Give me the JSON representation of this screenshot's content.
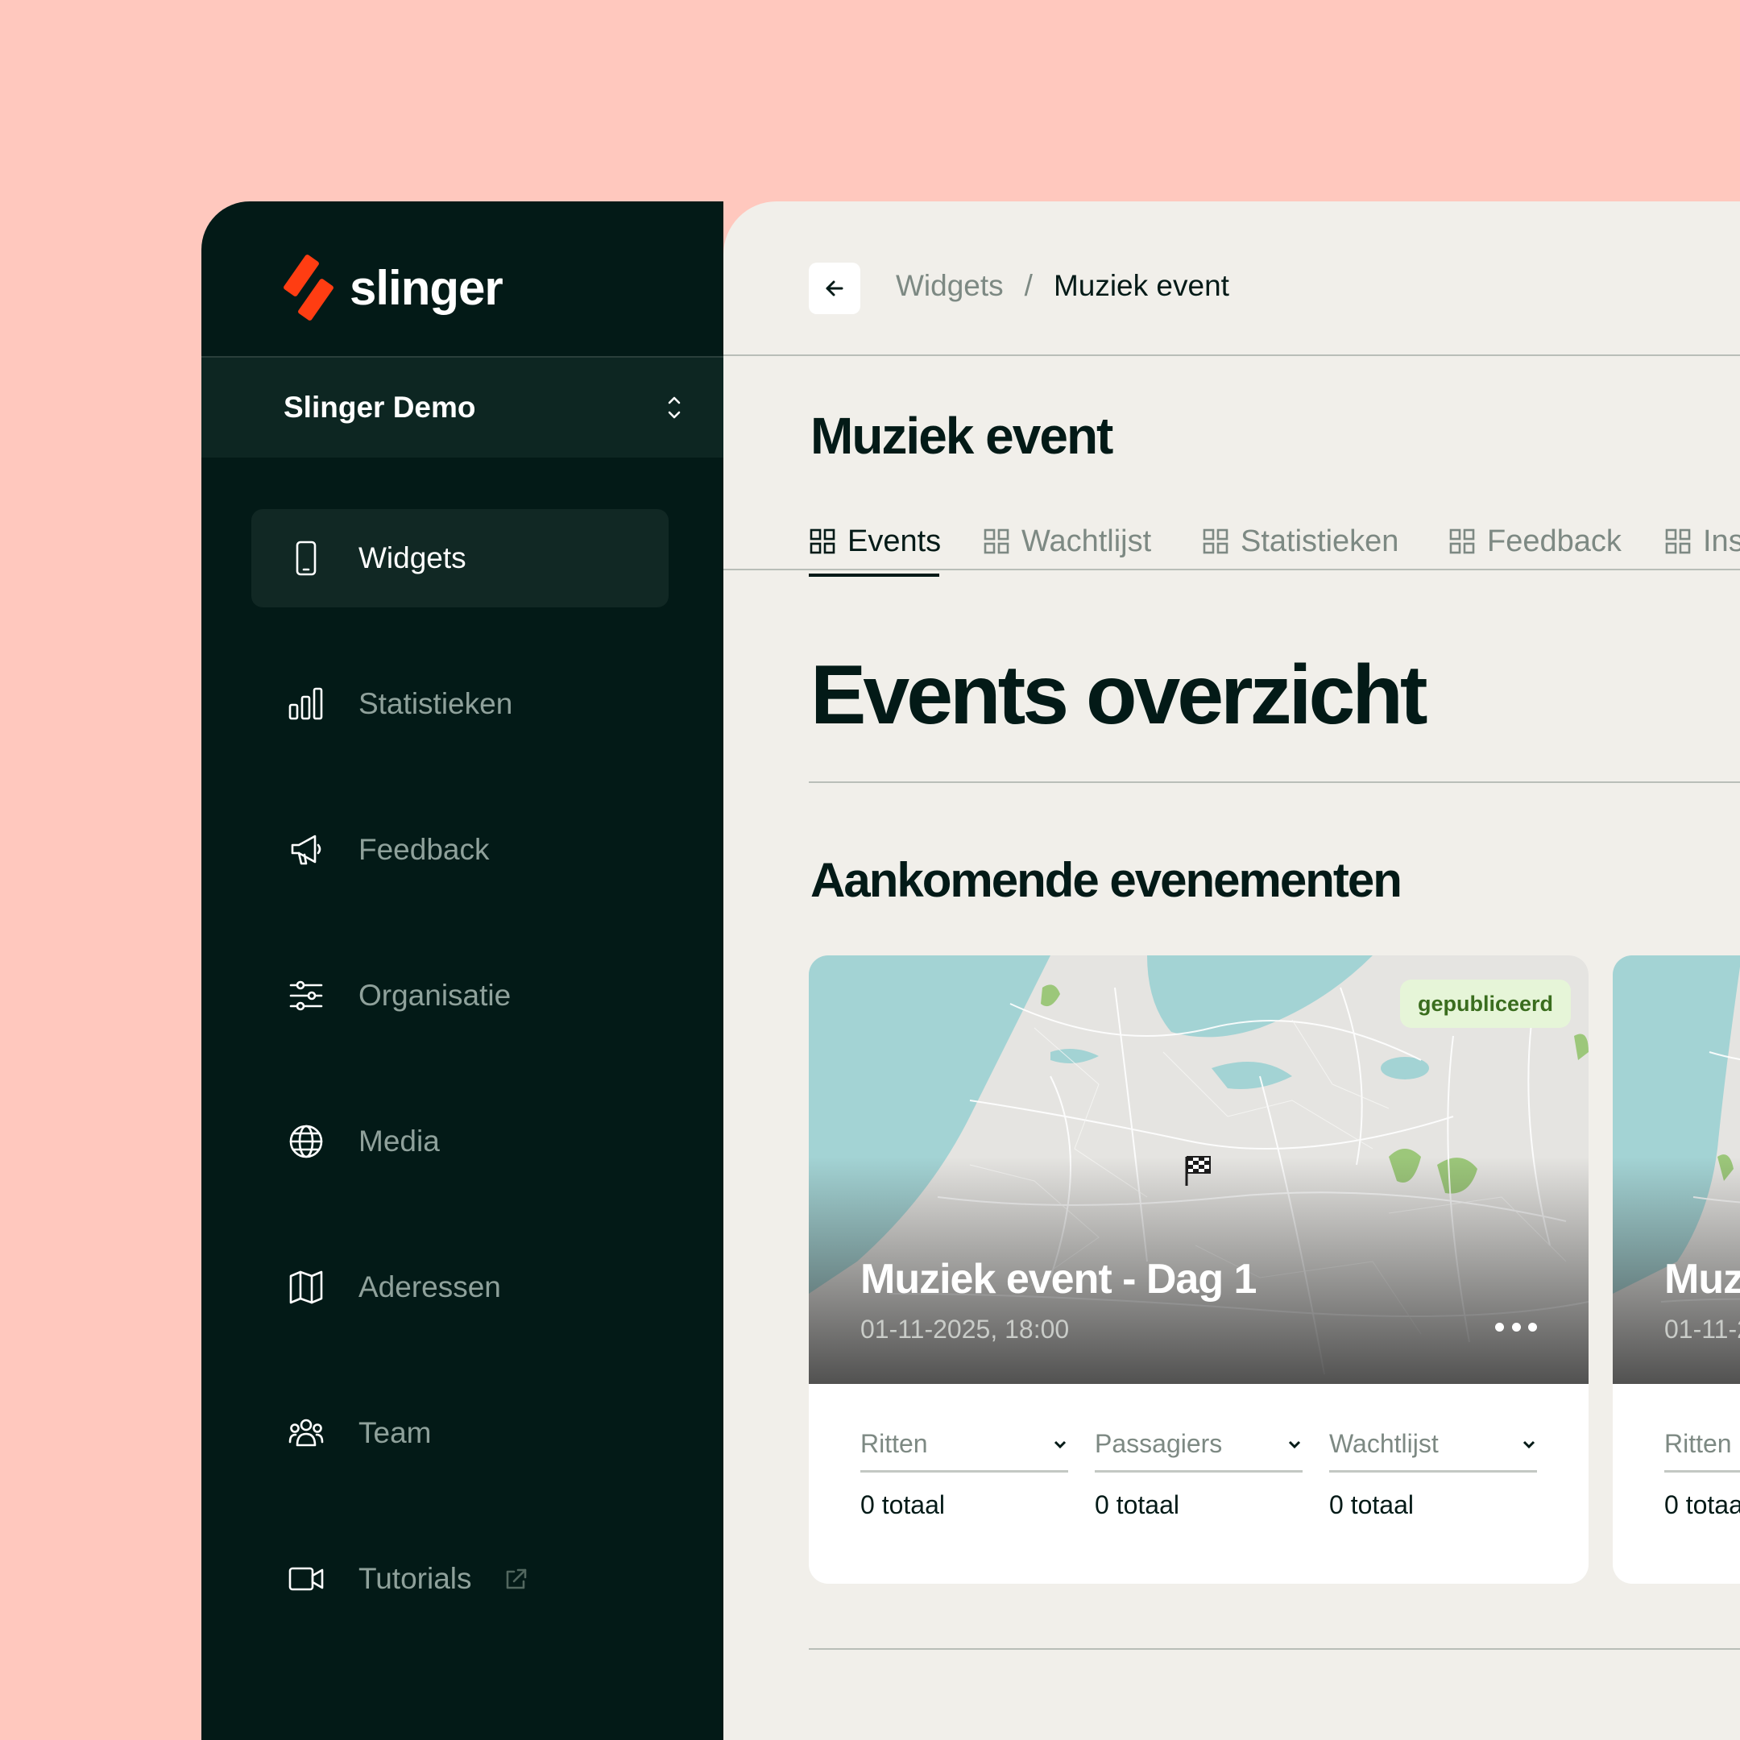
{
  "brand": {
    "name": "slinger",
    "accent": "#ff3d12",
    "sidebar_bg": "#031a17",
    "page_bg": "#ffc8be"
  },
  "org_switcher": {
    "label": "Slinger Demo",
    "icon": "chevron-up-down-icon"
  },
  "sidebar": {
    "items": [
      {
        "label": "Widgets",
        "icon": "smartphone-icon",
        "active": true
      },
      {
        "label": "Statistieken",
        "icon": "bar-chart-icon"
      },
      {
        "label": "Feedback",
        "icon": "megaphone-icon"
      },
      {
        "label": "Organisatie",
        "icon": "sliders-icon"
      },
      {
        "label": "Media",
        "icon": "globe-icon"
      },
      {
        "label": "Aderessen",
        "icon": "map-icon"
      },
      {
        "label": "Team",
        "icon": "users-icon"
      },
      {
        "label": "Tutorials",
        "icon": "video-icon",
        "external_icon": "external-link-icon"
      }
    ]
  },
  "breadcrumb": {
    "parent": "Widgets",
    "separator": "/",
    "current": "Muziek event"
  },
  "page": {
    "title": "Muziek event"
  },
  "tabs": [
    {
      "label": "Events",
      "active": true
    },
    {
      "label": "Wachtlijst"
    },
    {
      "label": "Statistieken"
    },
    {
      "label": "Feedback"
    },
    {
      "label": "Ins"
    }
  ],
  "section": {
    "title": "Events overzicht",
    "subtitle": "Aankomende evenementen"
  },
  "events": [
    {
      "status": "gepubliceerd",
      "title": "Muziek event - Dag 1",
      "date": "01-11-2025, 18:00",
      "stats": [
        {
          "label": "Ritten",
          "value": "0 totaal"
        },
        {
          "label": "Passagiers",
          "value": "0 totaal"
        },
        {
          "label": "Wachtlijst",
          "value": "0 totaal"
        }
      ]
    },
    {
      "title": "Muz",
      "date": "01-11-2",
      "stats": [
        {
          "label": "Ritten",
          "value": "0 totaa"
        }
      ]
    }
  ]
}
